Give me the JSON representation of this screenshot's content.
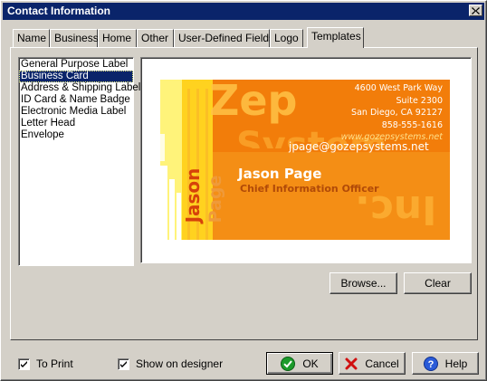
{
  "window": {
    "title": "Contact Information",
    "close_symbol": "×"
  },
  "tabs": [
    {
      "label": "Name",
      "active": false
    },
    {
      "label": "Business",
      "active": false
    },
    {
      "label": "Home",
      "active": false
    },
    {
      "label": "Other",
      "active": false
    },
    {
      "label": "User-Defined Fields",
      "active": false
    },
    {
      "label": "Logo",
      "active": false
    },
    {
      "label": "Templates",
      "active": true
    }
  ],
  "templates": {
    "items": [
      "General Purpose Label",
      "Business Card",
      "Address & Shipping Label",
      "ID Card & Name Badge",
      "Electronic Media Label",
      "Letter Head",
      "Envelope"
    ],
    "selected_index": 1
  },
  "card": {
    "address1": "4600 West Park Way",
    "address2": "Suite 2300",
    "city": "San Diego, CA 92127",
    "phone": "858-555-1616",
    "web": "www.gozepsystems.net",
    "email": "jpage@gozepsystems.net",
    "name": "Jason Page",
    "position": "Chief Information Officer",
    "bg_word1": "Zep",
    "bg_word2": "System",
    "vertical1": "Jason",
    "vertical2": "Page",
    "mirror_text": "Inc.",
    "colors": {
      "orange": "#f57f0c",
      "yellow": "#ffd21f",
      "light_yellow": "#fff37a"
    }
  },
  "buttons": {
    "browse": "Browse...",
    "clear": "Clear",
    "ok": "OK",
    "cancel": "Cancel",
    "help": "Help"
  },
  "checks": {
    "to_print": {
      "label": "To Print",
      "checked": true
    },
    "show_on_designer": {
      "label": "Show on designer",
      "checked": true
    }
  }
}
